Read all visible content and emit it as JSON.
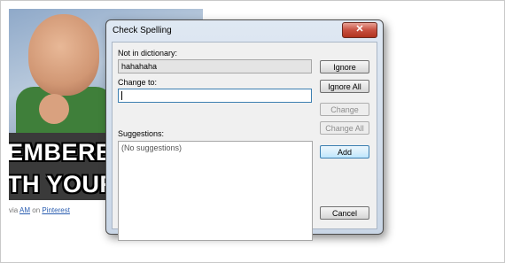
{
  "page": {
    "meme_line1": "EMBERED T",
    "meme_line2": "TH YOUR S",
    "credit_via": "via ",
    "credit_user": "AM",
    "credit_on": " on ",
    "credit_site": "Pinterest"
  },
  "dialog": {
    "title": "Check Spelling",
    "close_glyph": "✕",
    "not_in_dictionary_label": "Not in dictionary:",
    "not_in_dictionary_value": "hahahaha",
    "change_to_label": "Change to:",
    "change_to_value": "",
    "suggestions_label": "Suggestions:",
    "suggestions_placeholder": "(No suggestions)",
    "buttons": {
      "ignore": "Ignore",
      "ignore_all": "Ignore All",
      "change": "Change",
      "change_all": "Change All",
      "add": "Add",
      "cancel": "Cancel"
    }
  },
  "icons": {
    "close": "close-icon"
  },
  "colors": {
    "close_button": "#c75040",
    "link": "#2a5db0",
    "focus_border": "#3c7fb1"
  }
}
